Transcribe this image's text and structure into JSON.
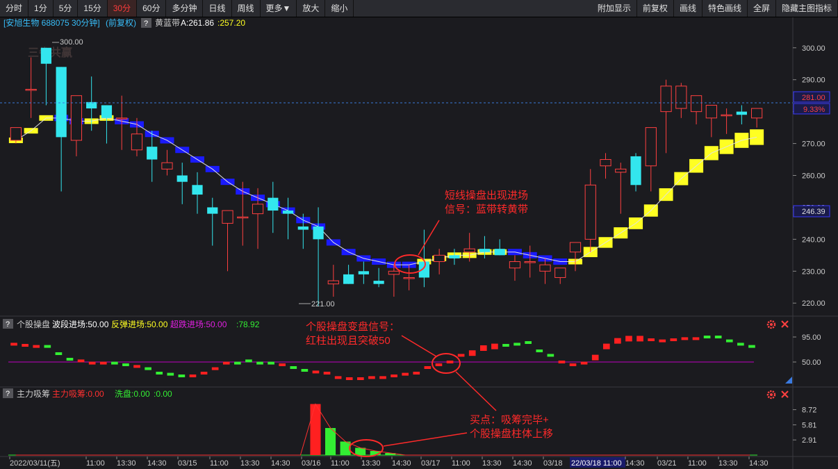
{
  "toolbar": {
    "left": [
      "分时",
      "1分",
      "5分",
      "15分",
      "30分",
      "60分",
      "多分钟",
      "日线",
      "周线",
      "更多▼",
      "放大",
      "缩小"
    ],
    "active": "30分",
    "right": [
      "附加显示",
      "前复权",
      "画线",
      "特色画线",
      "全屏",
      "隐藏主图指标"
    ]
  },
  "main_header": {
    "stock": "[安旭生物 688075 30分钟]",
    "adj": "(前复权)",
    "help": "?",
    "indicator": "黄蓝带",
    "a_label": "A:261.86",
    "b_label": ":257.20"
  },
  "sub1_header": {
    "help": "?",
    "name": "个股操盘",
    "v1": "波段进场:50.00",
    "v2": "反弹进场:50.00",
    "v3": "超跌进场:50.00",
    "v4": ":78.92"
  },
  "sub2_header": {
    "help": "?",
    "name": "主力吸筹",
    "v1": "主力吸筹:0.00",
    "v2": "洗盘:0.00",
    "v3": ":0.00"
  },
  "watermark": "三牛共赢",
  "annotations": {
    "a1_line1": "短线操盘出现进场",
    "a1_line2": "信号：蓝带转黄带",
    "a2_line1": "个股操盘变盘信号：",
    "a2_line2": "红柱出现且突破50",
    "a3_line1": "买点：吸筹完毕+",
    "a3_line2": "个股操盘柱体上移"
  },
  "price_labels": {
    "high": "300.00",
    "low": "221.00",
    "current": "281.00",
    "current_pct": "9.33%",
    "band": "246.39"
  },
  "x_labels": [
    "2022/03/11(五)",
    "11:00",
    "13:30",
    "14:30",
    "03/15",
    "11:00",
    "13:30",
    "14:30",
    "03/16",
    "11:00",
    "13:30",
    "14:30",
    "03/17",
    "11:00",
    "13:30",
    "14:30",
    "03/18",
    "22/03/18 11:00",
    "14:30",
    "03/21",
    "11:00",
    "13:30",
    "14:30"
  ],
  "colors": {
    "up": "#ff4040",
    "down": "#33e6ee",
    "yellow": "#ffff22",
    "blue": "#1a1aff",
    "magenta": "#c000c0",
    "green": "#33ee33",
    "red": "#ff2020",
    "annot": "#ff2a2a"
  },
  "chart_data": [
    {
      "type": "candlestick",
      "title": "[安旭生物 688075 30分钟] (前复权) 黄蓝带",
      "y_ticks": [
        300,
        290,
        280,
        270,
        260,
        250,
        240,
        230,
        220
      ],
      "ylim": [
        217,
        303
      ],
      "candles": [
        [
          271,
          275,
          270,
          275,
          269
        ],
        [
          287,
          297,
          278,
          287,
          279
        ],
        [
          300,
          300,
          282,
          295,
          280
        ],
        [
          294,
          294,
          255,
          272,
          284
        ],
        [
          271,
          283,
          266,
          285,
          275
        ],
        [
          283,
          291,
          274,
          281,
          286
        ],
        [
          282,
          282,
          270,
          278,
          287
        ],
        [
          278,
          285,
          268,
          278,
          280
        ],
        [
          268,
          278,
          266,
          273,
          269
        ],
        [
          269,
          274,
          258,
          265,
          266
        ],
        [
          262,
          268,
          260,
          264,
          264
        ],
        [
          260,
          264,
          251,
          258,
          259
        ],
        [
          257,
          261,
          248,
          254,
          256
        ],
        [
          250,
          253,
          238,
          248,
          252
        ],
        [
          245,
          248,
          230,
          249,
          243
        ],
        [
          247,
          258,
          238,
          247,
          248
        ],
        [
          248,
          256,
          237,
          251,
          246
        ],
        [
          253,
          258,
          242,
          249,
          245
        ],
        [
          249,
          253,
          240,
          248,
          244
        ],
        [
          244,
          248,
          237,
          243,
          242
        ],
        [
          244,
          250,
          219,
          240,
          233
        ],
        [
          226,
          232,
          222,
          227,
          228
        ],
        [
          229,
          232,
          226,
          226,
          227
        ],
        [
          230,
          233,
          226,
          229,
          228
        ],
        [
          227,
          231,
          225,
          226,
          227
        ],
        [
          229,
          232,
          222,
          230,
          230
        ],
        [
          228,
          232,
          224,
          228,
          230
        ],
        [
          233,
          243,
          225,
          228,
          233
        ],
        [
          233,
          237,
          229,
          235,
          235
        ],
        [
          235,
          237,
          232,
          234,
          236
        ],
        [
          236,
          242,
          233,
          237,
          236
        ],
        [
          237,
          241,
          234,
          236,
          237
        ],
        [
          237,
          240,
          235,
          235,
          238
        ],
        [
          231,
          235,
          227,
          233,
          232
        ],
        [
          233,
          238,
          228,
          233,
          234
        ],
        [
          230,
          234,
          226,
          232,
          231
        ],
        [
          228,
          231,
          226,
          231,
          228
        ],
        [
          236,
          238,
          230,
          239,
          232
        ],
        [
          240,
          262,
          236,
          257,
          236
        ],
        [
          263,
          267,
          259,
          265,
          259
        ],
        [
          261,
          264,
          248,
          262,
          250
        ],
        [
          266,
          267,
          255,
          257,
          256
        ],
        [
          263,
          268,
          255,
          275,
          266
        ],
        [
          280,
          290,
          267,
          288,
          286
        ],
        [
          281,
          289,
          278,
          288,
          280
        ],
        [
          280,
          283,
          276,
          285,
          281
        ],
        [
          278,
          282,
          272,
          282,
          278
        ],
        [
          279,
          281,
          273,
          279,
          278
        ],
        [
          280,
          282,
          276,
          279,
          278
        ],
        [
          278,
          281,
          275,
          281,
          277
        ]
      ],
      "band": [
        271,
        274,
        278,
        278,
        277,
        277,
        278,
        277,
        276,
        273,
        271,
        268,
        265,
        262,
        258,
        255,
        253,
        251,
        249,
        246,
        244,
        239,
        236,
        234,
        233,
        232,
        232,
        233,
        234,
        235,
        235,
        236,
        236,
        236,
        235,
        234,
        233,
        233,
        236,
        239,
        242,
        245,
        249,
        254,
        259,
        263,
        267,
        269,
        271,
        272
      ],
      "band_colors": [
        "yellow",
        "yellow",
        "yellow",
        "blue",
        "blue",
        "yellow",
        "yellow",
        "blue",
        "blue",
        "blue",
        "blue",
        "blue",
        "blue",
        "blue",
        "blue",
        "blue",
        "blue",
        "blue",
        "blue",
        "blue",
        "blue",
        "blue",
        "blue",
        "blue",
        "blue",
        "blue",
        "blue",
        "yellow",
        "yellow",
        "yellow",
        "yellow",
        "yellow",
        "yellow",
        "blue",
        "blue",
        "blue",
        "blue",
        "yellow",
        "yellow",
        "yellow",
        "yellow",
        "yellow",
        "yellow",
        "yellow",
        "yellow",
        "yellow",
        "yellow",
        "yellow",
        "yellow",
        "yellow"
      ]
    },
    {
      "type": "bar",
      "title": "个股操盘",
      "y_ticks": [
        95,
        50
      ],
      "ylim": [
        10,
        105
      ],
      "line_value": 50,
      "values": [
        82,
        80,
        78,
        78,
        65,
        55,
        52,
        48,
        48,
        48,
        45,
        42,
        38,
        30,
        28,
        25,
        25,
        30,
        38,
        48,
        48,
        52,
        48,
        48,
        45,
        40,
        35,
        32,
        30,
        22,
        20,
        20,
        22,
        22,
        25,
        28,
        30,
        40,
        45,
        50,
        62,
        66,
        75,
        78,
        80,
        82,
        85,
        70,
        62,
        50,
        45,
        48,
        58,
        78,
        88,
        92,
        92,
        90,
        88,
        90,
        92,
        92,
        95,
        95,
        88,
        82,
        78
      ],
      "colors": [
        "red",
        "red",
        "red",
        "green",
        "green",
        "green",
        "red",
        "red",
        "red",
        "green",
        "green",
        "red",
        "green",
        "green",
        "green",
        "green",
        "red",
        "red",
        "red",
        "red",
        "green",
        "green",
        "green",
        "green",
        "red",
        "green",
        "green",
        "red",
        "red",
        "red",
        "red",
        "red",
        "red",
        "red",
        "red",
        "red",
        "red",
        "red",
        "red",
        "red",
        "red",
        "red",
        "red",
        "red",
        "green",
        "green",
        "green",
        "green",
        "green",
        "red",
        "red",
        "red",
        "red",
        "red",
        "red",
        "red",
        "red",
        "red",
        "red",
        "red",
        "red",
        "red",
        "green",
        "green",
        "green",
        "green",
        "green"
      ]
    },
    {
      "type": "bar",
      "title": "主力吸筹",
      "y_ticks": [
        8.72,
        5.81,
        2.91
      ],
      "ylim": [
        0,
        10
      ],
      "values": [
        0,
        0,
        0,
        0,
        0,
        0,
        0,
        0,
        0,
        0,
        0,
        0,
        0,
        0,
        0,
        0,
        0,
        0,
        0,
        0,
        9.8,
        5.2,
        2.6,
        1.4,
        0.8,
        0.4,
        0,
        0,
        0,
        0,
        0,
        0,
        0,
        0,
        0,
        0,
        0,
        0,
        0,
        0,
        0,
        0,
        0,
        0,
        0,
        0,
        0,
        0,
        0,
        0
      ],
      "colors": [
        "red",
        "red",
        "red",
        "red",
        "red",
        "red",
        "red",
        "red",
        "red",
        "red",
        "red",
        "red",
        "red",
        "red",
        "red",
        "red",
        "red",
        "red",
        "red",
        "red",
        "red",
        "green",
        "green",
        "green",
        "green",
        "green",
        "green",
        "green",
        "green",
        "green",
        "green",
        "green",
        "green",
        "green",
        "green",
        "green",
        "green",
        "green",
        "green",
        "green",
        "green",
        "green",
        "green",
        "green",
        "green",
        "green",
        "green",
        "green",
        "green",
        "green"
      ]
    }
  ]
}
